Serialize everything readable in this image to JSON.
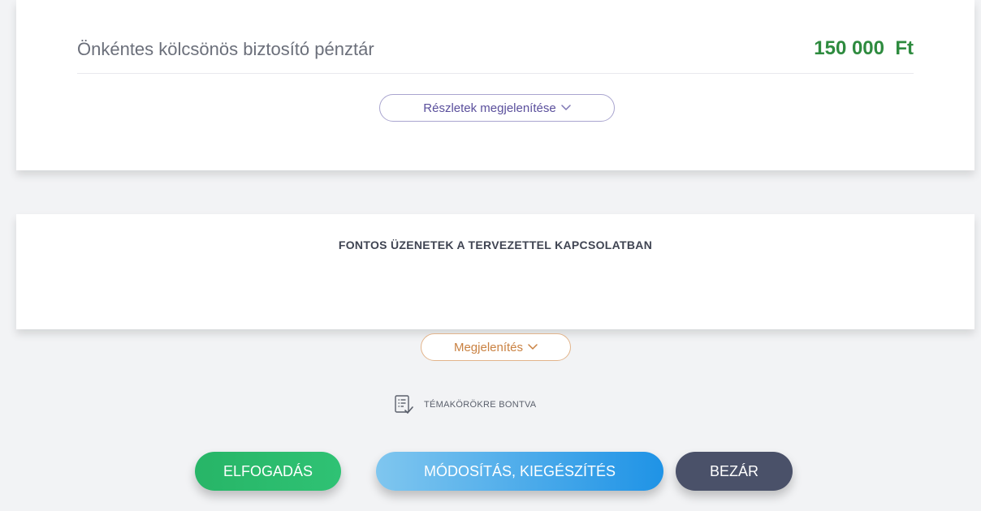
{
  "summary": {
    "row_label": "Önkéntes kölcsönös biztosító pénztár",
    "row_amount": "150 000  Ft",
    "details_button": "Részletek megjelenítése"
  },
  "messages": {
    "title": "FONTOS ÜZENETEK A TERVEZETTEL KAPCSOLATBAN",
    "show_button": "Megjelenítés"
  },
  "topics": {
    "label": "TÉMAKÖRÖKRE BONTVA",
    "icon": "checklist-icon"
  },
  "actions": {
    "accept": "ELFOGADÁS",
    "modify": "MÓDOSÍTÁS, KIEGÉSZÍTÉS",
    "close": "BEZÁR"
  },
  "colors": {
    "amount_green": "#2e8b3f",
    "details_purple": "#5a4f9c",
    "show_orange": "#c98141",
    "accept_green": "#2fc274",
    "modify_blue": "#1f93e6",
    "close_slate": "#4a5169"
  }
}
